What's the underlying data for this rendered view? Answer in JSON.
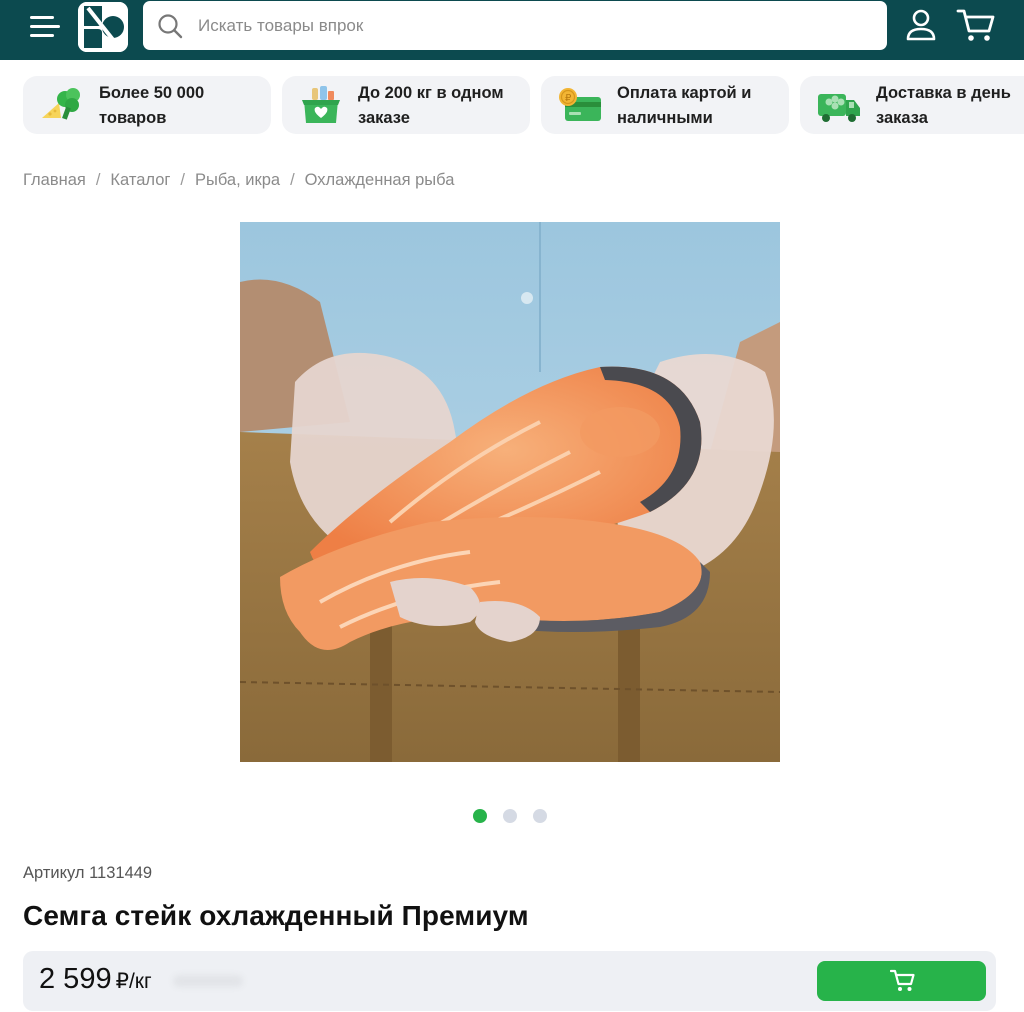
{
  "header": {
    "search_placeholder": "Искать товары впрок",
    "logo_icon": "logo-icon",
    "menu_icon": "menu-icon",
    "user_icon": "user-icon",
    "cart_icon": "cart-icon",
    "bg_color": "#0c4a4f"
  },
  "features": [
    {
      "text": "Более 50 000 товаров",
      "icon": "grocery-icon"
    },
    {
      "text": "До 200 кг в одном заказе",
      "icon": "box-icon"
    },
    {
      "text": "Оплата картой и наличными",
      "icon": "payment-card-icon"
    },
    {
      "text": "Доставка в день заказа",
      "icon": "delivery-truck-icon"
    }
  ],
  "breadcrumb": [
    "Главная",
    "Каталог",
    "Рыба, икра",
    "Охлажденная рыба"
  ],
  "gallery": {
    "image": "salmon-steak-photo",
    "slides": 3,
    "active_slide": 1,
    "active_color": "#27b34a",
    "inactive_color": "#d5dae4"
  },
  "product": {
    "article": "Артикул 1131449",
    "title": "Семга стейк охлажденный Премиум",
    "price": "2 599",
    "unit": "₽/кг"
  },
  "buy_button": {
    "icon": "cart-icon",
    "color": "#27b34a"
  }
}
